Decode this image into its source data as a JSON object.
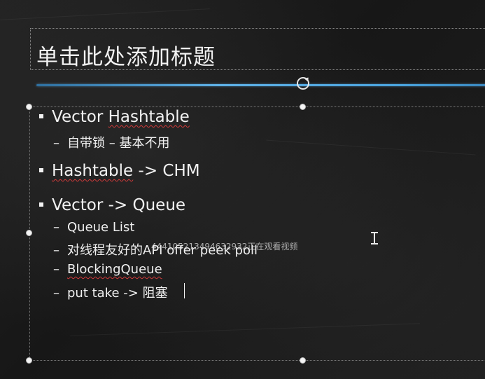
{
  "slide": {
    "title_placeholder": "单击此处添加标题",
    "accent_color": "#4aa3dd",
    "bullets": [
      {
        "text_a": "Vector ",
        "text_b": "Hashtable",
        "sub": [
          "自带锁 – 基本不用"
        ]
      },
      {
        "text_a": "Hashtable",
        "text_b": " -> CHM",
        "sub": []
      },
      {
        "text_a": "Vector -> Queue",
        "sub": [
          "Queue List",
          "对线程友好的API offer peek poll",
          "BlockingQueue",
          "put take -> 阻塞"
        ]
      }
    ],
    "dash": "–",
    "watermark": "444105213494632932正在观看视频"
  },
  "icons": {
    "rotate_handle": "rotate-icon",
    "mouse_cursor": "i-beam-cursor-icon",
    "bullet": "square-bullet-icon"
  }
}
